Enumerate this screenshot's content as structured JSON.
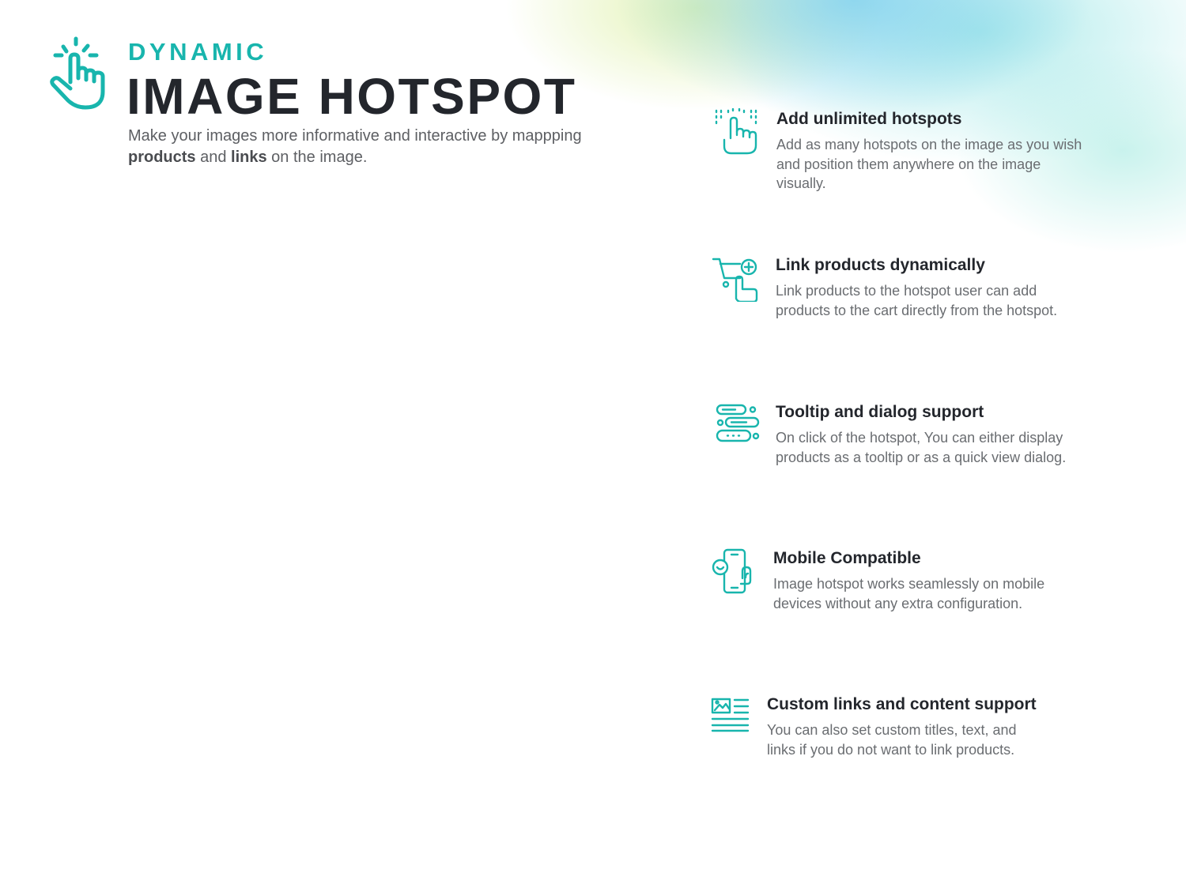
{
  "brand": {
    "eyebrow": "DYNAMIC",
    "title": "IMAGE HOTSPOT",
    "tagline_before": "Make your images more informative and interactive by mappping ",
    "tagline_bold_1": "products",
    "tagline_middle": " and ",
    "tagline_bold_2": "links",
    "tagline_after": " on the image."
  },
  "features": [
    {
      "title": "Add unlimited hotspots",
      "text": "Add as many hotspots on the image as you wish and position them anywhere on the image visually.",
      "icon": "tap-hotspot-icon"
    },
    {
      "title": "Link products dynamically",
      "text": "Link products to the hotspot user can add products to the cart directly from the hotspot.",
      "icon": "cart-link-icon"
    },
    {
      "title": "Tooltip and dialog support",
      "text": "On click of the hotspot, You can either display products as a tooltip or as a quick view dialog.",
      "icon": "chat-dialog-icon"
    },
    {
      "title": "Mobile Compatible",
      "text": "Image hotspot works seamlessly on mobile devices without any extra configuration.",
      "icon": "mobile-device-icon"
    },
    {
      "title": "Custom links and content support",
      "text": "You can also set custom titles, text, and links if you do not want to link products.",
      "icon": "content-layout-icon"
    }
  ],
  "colors": {
    "accent": "#18b5ad",
    "title_text": "#23262c",
    "body_text": "#6a6d71"
  }
}
